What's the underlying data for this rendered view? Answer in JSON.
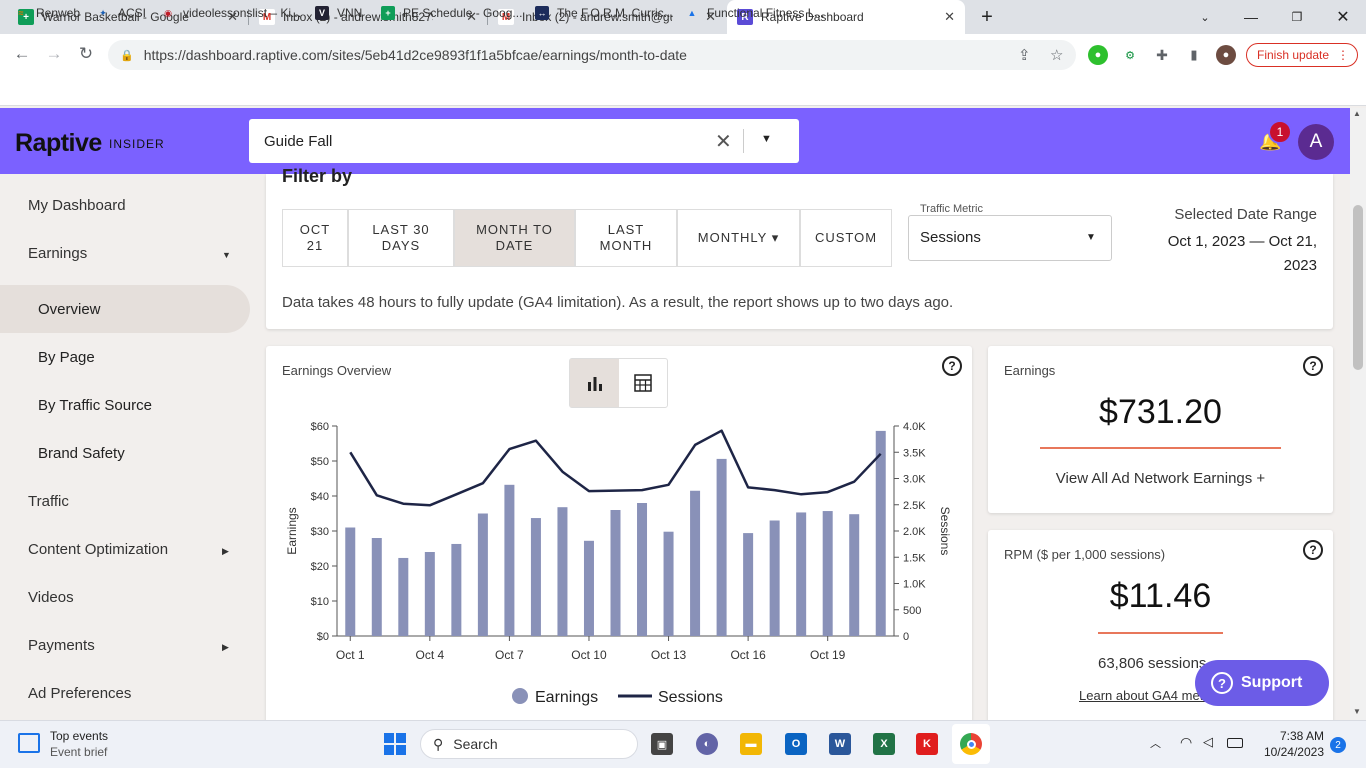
{
  "browser": {
    "tabs": [
      {
        "title": "Warrior Basketball - Google Sheets",
        "icon": "sheets-icon"
      },
      {
        "title": "Inbox (2) - andrew.smith8279@gmail.com",
        "icon": "gmail-icon"
      },
      {
        "title": "Inbox (2) - andrew.smith@guide",
        "icon": "gmail-icon"
      },
      {
        "title": "Raptive Dashboard",
        "icon": "raptive-icon"
      }
    ],
    "url": "https://dashboard.raptive.com/sites/5eb41d2ce9893f1f1a5bfcae/earnings/month-to-date",
    "finish_update": "Finish update",
    "bookmarks": [
      "Renweb",
      "ACSI",
      "videolessonslist – Ki...",
      "VNN",
      "PE Schedule - Goog...",
      "The F.O.R.M. Curric...",
      "Functional Fitness L..."
    ]
  },
  "header": {
    "logo": "Raptive",
    "logo_sub": "INSIDER",
    "search_value": "Guide Fall",
    "notification_count": "1",
    "avatar_letter": "A"
  },
  "sidebar": {
    "items": [
      "My Dashboard",
      "Earnings",
      "Overview",
      "By Page",
      "By Traffic Source",
      "Brand Safety",
      "Traffic",
      "Content Optimization",
      "Videos",
      "Payments",
      "Ad Preferences"
    ]
  },
  "filter": {
    "title": "Filter by",
    "options": [
      {
        "l1": "OCT",
        "l2": "21"
      },
      {
        "l1": "LAST 30",
        "l2": "DAYS"
      },
      {
        "l1": "MONTH TO",
        "l2": "DATE"
      },
      {
        "l1": "LAST",
        "l2": "MONTH"
      },
      {
        "l1": "MONTHLY ▾",
        "l2": ""
      },
      {
        "l1": "CUSTOM",
        "l2": ""
      }
    ],
    "traffic_metric_label": "Traffic Metric",
    "traffic_metric_value": "Sessions",
    "date_range_label": "Selected Date Range",
    "date_range_value": "Oct 1, 2023 — Oct 21, 2023",
    "note": "Data takes 48 hours to fully update (GA4 limitation). As a result, the report shows up to two days ago."
  },
  "chart_card": {
    "title": "Earnings Overview"
  },
  "chart_data": {
    "type": "bar",
    "categories": [
      "Oct 1",
      "Oct 2",
      "Oct 3",
      "Oct 4",
      "Oct 5",
      "Oct 6",
      "Oct 7",
      "Oct 8",
      "Oct 9",
      "Oct 10",
      "Oct 11",
      "Oct 12",
      "Oct 13",
      "Oct 14",
      "Oct 15",
      "Oct 16",
      "Oct 17",
      "Oct 18",
      "Oct 19",
      "Oct 20",
      "Oct 21"
    ],
    "x_tick_labels": [
      "Oct 1",
      "Oct 4",
      "Oct 7",
      "Oct 10",
      "Oct 13",
      "Oct 16",
      "Oct 19"
    ],
    "series": [
      {
        "name": "Earnings",
        "axis": "left",
        "type": "bar",
        "values": [
          31,
          28,
          22.3,
          24,
          26.3,
          35,
          43.2,
          33.7,
          36.8,
          27.2,
          36,
          38,
          29.8,
          41.5,
          50.6,
          29.4,
          33,
          35.3,
          35.7,
          34.8,
          58.6
        ]
      },
      {
        "name": "Sessions",
        "axis": "right",
        "type": "line",
        "values": [
          3500,
          2680,
          2520,
          2490,
          2700,
          2910,
          3560,
          3720,
          3130,
          2760,
          2770,
          2780,
          2880,
          3640,
          3910,
          2830,
          2780,
          2700,
          2740,
          2940,
          3470
        ]
      }
    ],
    "ylabel": "Earnings",
    "y2label": "Sessions",
    "ylim": [
      0,
      60
    ],
    "y_ticks": [
      "$0",
      "$10",
      "$20",
      "$30",
      "$40",
      "$50",
      "$60"
    ],
    "y2lim": [
      0,
      4000
    ],
    "y2_ticks": [
      "0",
      "500",
      "1.0K",
      "1.5K",
      "2.0K",
      "2.5K",
      "3.0K",
      "3.5K",
      "4.0K"
    ],
    "legend": [
      "Earnings",
      "Sessions"
    ],
    "bar_color": "#8991b8",
    "line_color": "#1e2546"
  },
  "earnings_card": {
    "title": "Earnings",
    "value": "$731.20",
    "link": "View All Ad Network Earnings +"
  },
  "rpm_card": {
    "title": "RPM ($ per 1,000 sessions)",
    "value": "$11.46",
    "sessions": "63,806 sessions",
    "link": "Learn about GA4 metrics"
  },
  "support": "Support",
  "taskbar": {
    "weather_title": "Top events",
    "weather_sub": "Event brief",
    "search": "Search",
    "time": "7:38 AM",
    "date": "10/24/2023",
    "notifications": "2"
  }
}
